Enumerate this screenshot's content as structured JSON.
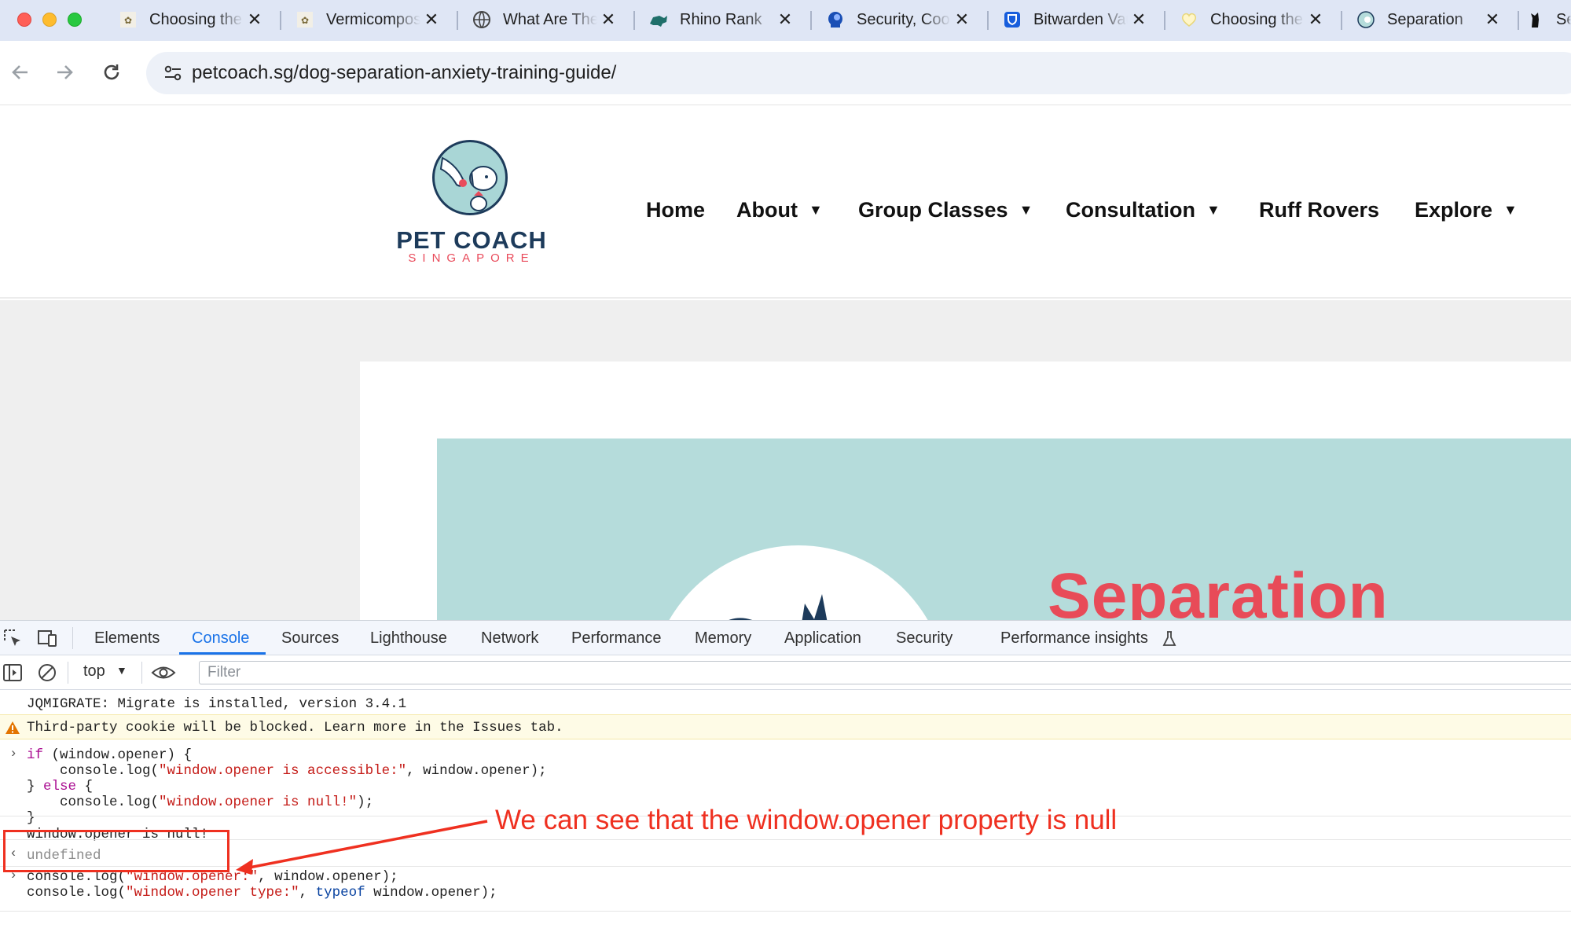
{
  "tabs": [
    {
      "title": "Choosing the Right",
      "icon": "pet-coach-favicon"
    },
    {
      "title": "Vermicomposting",
      "icon": "pet-coach-favicon"
    },
    {
      "title": "What Are They",
      "icon": "globe-icon"
    },
    {
      "title": "Rhino Rank",
      "icon": "rhino-icon"
    },
    {
      "title": "Security, Cookies",
      "icon": "shield-head-icon"
    },
    {
      "title": "Bitwarden Vault",
      "icon": "bitwarden-icon"
    },
    {
      "title": "Choosing the",
      "icon": "heart-icon"
    },
    {
      "title": "Separation",
      "icon": "circle-dog-icon"
    },
    {
      "title": "Se",
      "icon": "dog-icon"
    }
  ],
  "address_bar": {
    "url": "petcoach.sg/dog-separation-anxiety-training-guide/"
  },
  "site": {
    "logo_title": "PET COACH",
    "logo_subtitle": "SINGAPORE",
    "nav": [
      "Home",
      "About",
      "Group Classes",
      "Consultation",
      "Ruff Rovers",
      "Explore"
    ],
    "hero_word": "Separation"
  },
  "devtools": {
    "tabs": [
      "Elements",
      "Console",
      "Sources",
      "Lighthouse",
      "Network",
      "Performance",
      "Memory",
      "Application",
      "Security",
      "Performance insights"
    ],
    "active_tab": "Console",
    "context": "top",
    "filter_placeholder": "Filter",
    "console": {
      "log1": "JQMIGRATE: Migrate is installed, version 3.4.1",
      "warning": "Third-party cookie will be blocked. Learn more in the Issues tab.",
      "code1_l1_kw": "if",
      "code1_l1_rest": " (window.opener) {",
      "code1_l2_a": "    console.log(",
      "code1_l2_str": "\"window.opener is accessible:\"",
      "code1_l2_b": ", window.opener);",
      "code1_l3_a": "} ",
      "code1_l3_kw": "else",
      "code1_l3_b": " {",
      "code1_l4_a": "    console.log(",
      "code1_l4_str": "\"window.opener is null!\"",
      "code1_l4_b": ");",
      "code1_l5": "}",
      "output1": "window.opener is null!",
      "return1": "undefined",
      "code2_l1_a": "console.log(",
      "code2_l1_str": "\"window.opener:\"",
      "code2_l1_b": ", window.opener);",
      "code2_l2_a": "console.log(",
      "code2_l2_str": "\"window.opener type:\"",
      "code2_l2_c": ", ",
      "code2_l2_kw": "typeof",
      "code2_l2_b": " window.opener);"
    }
  },
  "annotation": {
    "text": "We can see that the window.opener property is null",
    "color": "#ef3020"
  }
}
